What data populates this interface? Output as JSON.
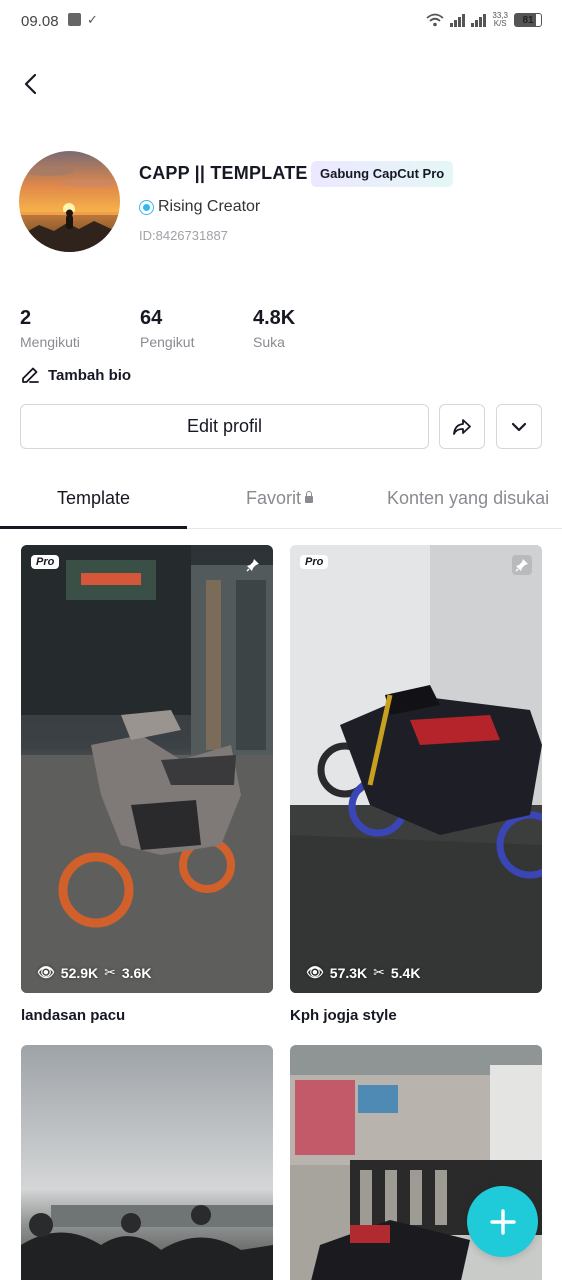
{
  "status_bar": {
    "time": "09.08",
    "speed_top": "33,3",
    "speed_bottom": "K/S",
    "battery": "81"
  },
  "header": {
    "back_icon": "chevron-left-icon"
  },
  "profile": {
    "name": "CAPP || TEMPLATE",
    "pro_badge": "Gabung CapCut Pro",
    "creator_label": "Rising Creator",
    "id": "ID:8426731887"
  },
  "stats": [
    {
      "value": "2",
      "label": "Mengikuti"
    },
    {
      "value": "64",
      "label": "Pengikut"
    },
    {
      "value": "4.8K",
      "label": "Suka"
    }
  ],
  "bio": {
    "label": "Tambah bio",
    "icon": "pencil-icon"
  },
  "actions": {
    "edit_label": "Edit profil",
    "share_icon": "share-arrow-icon",
    "more_icon": "chevron-down-icon"
  },
  "tabs": [
    {
      "label": "Template",
      "active": true
    },
    {
      "label": "Favorit",
      "locked": true
    },
    {
      "label": "Konten yang disukai"
    }
  ],
  "templates": [
    {
      "title": "landasan pacu",
      "views": "52.9K",
      "uses": "3.6K",
      "pro": "Pro"
    },
    {
      "title": "Kph jogja style",
      "views": "57.3K",
      "uses": "5.4K",
      "pro": "Pro"
    },
    {
      "title": "",
      "views": "",
      "uses": ""
    },
    {
      "title": "",
      "views": "",
      "uses": ""
    }
  ],
  "colors": {
    "accent": "#1fcbd8",
    "text": "#161823",
    "muted": "#8a8b91"
  }
}
